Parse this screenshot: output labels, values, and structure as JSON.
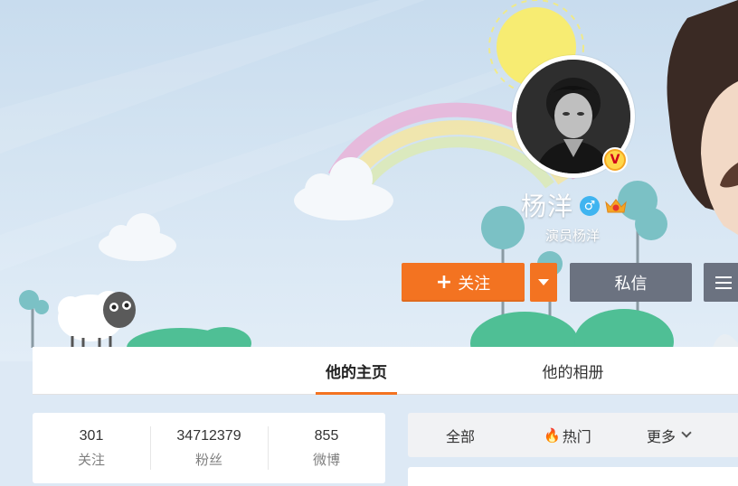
{
  "profile": {
    "name": "杨洋",
    "verified_title": "演员杨洋",
    "gender_icon": "male-icon",
    "verified_badge_icon": "v-badge-icon",
    "vip_icon": "vip-crown-icon"
  },
  "actions": {
    "follow_label": "关注",
    "follow_icon": "plus-icon",
    "dropdown_icon": "caret-down-icon",
    "message_label": "私信",
    "menu_icon": "hamburger-menu-icon"
  },
  "tabs": [
    {
      "label": "他的主页",
      "active": true
    },
    {
      "label": "他的相册",
      "active": false
    }
  ],
  "stats": [
    {
      "value": "301",
      "label": "关注"
    },
    {
      "value": "34712379",
      "label": "粉丝"
    },
    {
      "value": "855",
      "label": "微博"
    }
  ],
  "filters": {
    "all_label": "全部",
    "hot_label": "热门",
    "hot_icon": "flame-icon",
    "more_label": "更多",
    "more_icon": "chevron-down-icon"
  },
  "colors": {
    "accent": "#f37321",
    "secondary_button": "#6b7280",
    "male": "#3fb4f0"
  }
}
